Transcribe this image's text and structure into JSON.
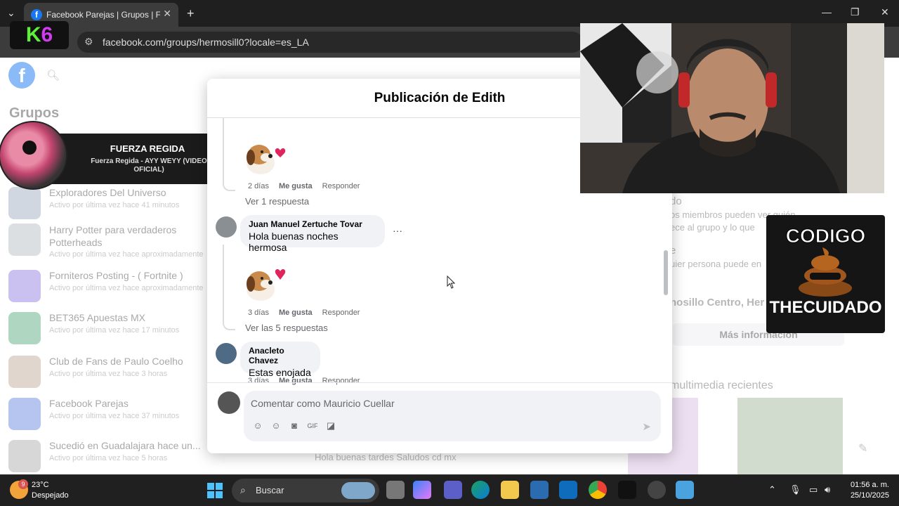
{
  "browser": {
    "tab_title": "Facebook Parejas | Grupos | Fac",
    "url": "facebook.com/groups/hermosill0?locale=es_LA"
  },
  "sidebar": {
    "title": "Grupos",
    "groups": [
      {
        "name": "Exploradores Del Universo",
        "activity": "Activo por última vez hace 41 minutos"
      },
      {
        "name": "Harry Potter para verdaderos Potterheads",
        "activity": "Activo por última vez hace aproximadamente"
      },
      {
        "name": "Forniteros Posting - ( Fortnite )",
        "activity": "Activo por última vez hace aproximadamente"
      },
      {
        "name": "BET365 Apuestas MX",
        "activity": "Activo por última vez hace 17 minutos"
      },
      {
        "name": "Club de Fans de Paulo Coelho",
        "activity": "Activo por última vez hace 3 horas"
      },
      {
        "name": "Facebook Parejas",
        "activity": "Activo por última vez hace 37 minutos"
      },
      {
        "name": "Sucedió en Guadalajara hace un...",
        "activity": "Activo por última vez hace 5 horas"
      }
    ]
  },
  "right_panel": {
    "line1": "do",
    "line2": "os miembros pueden ver quién",
    "line3": "ece al grupo y lo que",
    "line4": "e",
    "line5": "uier persona puede en",
    "location": "nosillo Centro, Her",
    "more_info": "Más información",
    "media_title": "multimedia recientes",
    "bottom_text": "Hola buenas tardes Saludos cd mx"
  },
  "music_overlay": {
    "artist": "FUERZA REGIDA",
    "song": "Fuerza Regida - AYY WEYY (VIDEO OFICIAL)"
  },
  "modal": {
    "title": "Publicación de Edith",
    "comments": [
      {
        "meta": {
          "time": "2 días",
          "like": "Me gusta",
          "reply": "Responder"
        },
        "view_replies": "Ver 1 respuesta"
      },
      {
        "author": "Juan Manuel Zertuche Tovar",
        "text": "Hola buenas noches hermosa",
        "more": "···",
        "meta": {
          "time": "3 días",
          "like": "Me gusta",
          "reply": "Responder"
        },
        "view_replies": "Ver las 5 respuestas"
      },
      {
        "author": "Anacleto Chavez",
        "text": "Estas enojada",
        "meta": {
          "time": "3 días",
          "like": "Me gusta",
          "reply": "Responder"
        }
      }
    ],
    "composer_placeholder": "Comentar como Mauricio Cuellar"
  },
  "overlays": {
    "k6_k": "K",
    "k6_6": "6",
    "codigo_line1": "CODIGO",
    "codigo_line2": "THECUIDADO"
  },
  "taskbar": {
    "temperature": "23°C",
    "condition": "Despejado",
    "weather_badge": "9",
    "search_label": "Buscar",
    "time": "01:56 a. m.",
    "date": "25/10/2025"
  },
  "colors": {
    "fb_blue": "#1877f2",
    "taskbar": "#202020"
  }
}
